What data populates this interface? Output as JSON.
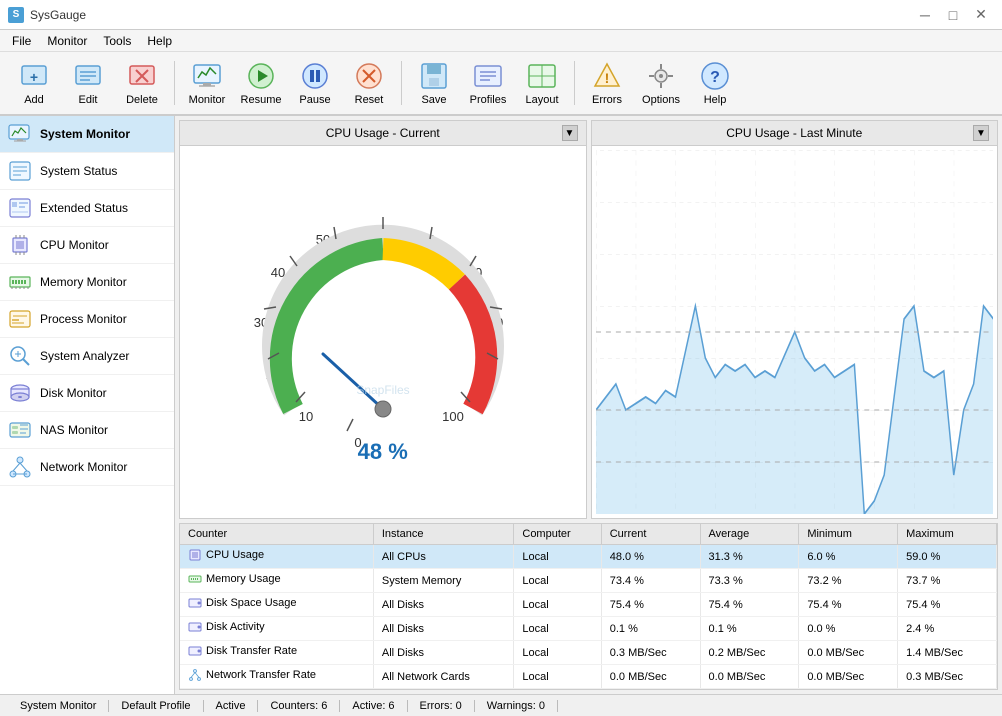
{
  "titlebar": {
    "icon": "S",
    "title": "SysGauge",
    "min_btn": "─",
    "max_btn": "□",
    "close_btn": "✕"
  },
  "menubar": {
    "items": [
      {
        "label": "File"
      },
      {
        "label": "Monitor"
      },
      {
        "label": "Tools"
      },
      {
        "label": "Help"
      }
    ]
  },
  "toolbar": {
    "buttons": [
      {
        "label": "Add",
        "icon": "add"
      },
      {
        "label": "Edit",
        "icon": "edit"
      },
      {
        "label": "Delete",
        "icon": "delete"
      },
      {
        "label": "Monitor",
        "icon": "monitor"
      },
      {
        "label": "Resume",
        "icon": "resume"
      },
      {
        "label": "Pause",
        "icon": "pause"
      },
      {
        "label": "Reset",
        "icon": "reset"
      },
      {
        "label": "Save",
        "icon": "save"
      },
      {
        "label": "Profiles",
        "icon": "profiles"
      },
      {
        "label": "Layout",
        "icon": "layout"
      },
      {
        "label": "Errors",
        "icon": "errors"
      },
      {
        "label": "Options",
        "icon": "options"
      },
      {
        "label": "Help",
        "icon": "help"
      }
    ]
  },
  "sidebar": {
    "items": [
      {
        "label": "System Monitor",
        "icon": "monitor",
        "active": true
      },
      {
        "label": "System Status",
        "icon": "status"
      },
      {
        "label": "Extended Status",
        "icon": "extended"
      },
      {
        "label": "CPU Monitor",
        "icon": "cpu"
      },
      {
        "label": "Memory Monitor",
        "icon": "memory"
      },
      {
        "label": "Process Monitor",
        "icon": "process"
      },
      {
        "label": "System Analyzer",
        "icon": "analyzer"
      },
      {
        "label": "Disk Monitor",
        "icon": "disk"
      },
      {
        "label": "NAS Monitor",
        "icon": "nas"
      },
      {
        "label": "Network Monitor",
        "icon": "network"
      }
    ]
  },
  "gauge_panel": {
    "title": "CPU Usage - Current",
    "value": 48,
    "value_display": "48 %"
  },
  "linechart_panel": {
    "title": "CPU Usage - Last Minute"
  },
  "table": {
    "headers": [
      "Counter",
      "Instance",
      "Computer",
      "Current",
      "Average",
      "Minimum",
      "Maximum"
    ],
    "rows": [
      {
        "icon": "cpu",
        "counter": "CPU Usage",
        "instance": "All CPUs",
        "computer": "Local",
        "current": "48.0 %",
        "average": "31.3 %",
        "minimum": "6.0 %",
        "maximum": "59.0 %",
        "selected": true
      },
      {
        "icon": "memory",
        "counter": "Memory Usage",
        "instance": "System Memory",
        "computer": "Local",
        "current": "73.4 %",
        "average": "73.3 %",
        "minimum": "73.2 %",
        "maximum": "73.7 %",
        "selected": false
      },
      {
        "icon": "disk",
        "counter": "Disk Space Usage",
        "instance": "All Disks",
        "computer": "Local",
        "current": "75.4 %",
        "average": "75.4 %",
        "minimum": "75.4 %",
        "maximum": "75.4 %",
        "selected": false
      },
      {
        "icon": "disk",
        "counter": "Disk Activity",
        "instance": "All Disks",
        "computer": "Local",
        "current": "0.1 %",
        "average": "0.1 %",
        "minimum": "0.0 %",
        "maximum": "2.4 %",
        "selected": false
      },
      {
        "icon": "disk",
        "counter": "Disk Transfer Rate",
        "instance": "All Disks",
        "computer": "Local",
        "current": "0.3 MB/Sec",
        "average": "0.2 MB/Sec",
        "minimum": "0.0 MB/Sec",
        "maximum": "1.4 MB/Sec",
        "selected": false
      },
      {
        "icon": "network",
        "counter": "Network Transfer Rate",
        "instance": "All Network Cards",
        "computer": "Local",
        "current": "0.0 MB/Sec",
        "average": "0.0 MB/Sec",
        "minimum": "0.0 MB/Sec",
        "maximum": "0.3 MB/Sec",
        "selected": false
      }
    ]
  },
  "statusbar": {
    "monitor": "System Monitor",
    "profile": "Default Profile",
    "active": "Active",
    "counters": "Counters: 6",
    "active_count": "Active: 6",
    "errors": "Errors: 0",
    "warnings": "Warnings: 0"
  }
}
